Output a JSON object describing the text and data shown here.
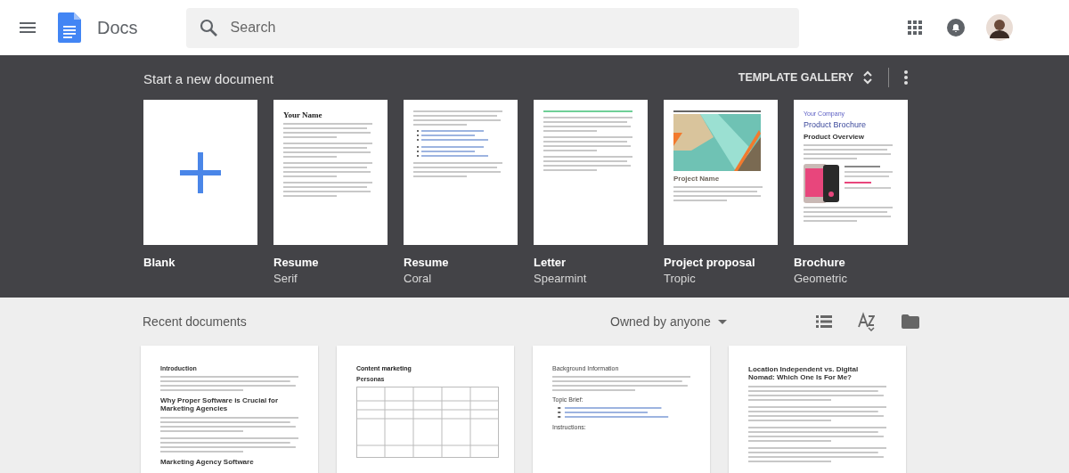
{
  "header": {
    "app_name": "Docs",
    "search": {
      "placeholder": "Search"
    }
  },
  "templates_section": {
    "title": "Start a new document",
    "gallery_button": "TEMPLATE GALLERY",
    "templates": [
      {
        "name": "Blank",
        "preview": [
          {
            "kind": "plus"
          }
        ]
      },
      {
        "name": "Resume",
        "variant": "Serif",
        "preview": [
          {
            "kind": "serif-title",
            "text": "Your Name"
          },
          {
            "kind": "lines"
          },
          {
            "kind": "lines"
          },
          {
            "kind": "lines"
          },
          {
            "kind": "lines"
          }
        ]
      },
      {
        "name": "Resume",
        "variant": "Coral",
        "preview": [
          {
            "kind": "lines"
          },
          {
            "kind": "bullets"
          },
          {
            "kind": "bullets"
          },
          {
            "kind": "lines"
          }
        ]
      },
      {
        "name": "Letter",
        "variant": "Spearmint",
        "preview": [
          {
            "kind": "rule"
          },
          {
            "kind": "lines"
          },
          {
            "kind": "lines"
          },
          {
            "kind": "lines"
          }
        ]
      },
      {
        "name": "Project proposal",
        "variant": "Tropic",
        "preview": [
          {
            "kind": "artwork"
          },
          {
            "kind": "condensed-title",
            "text": "Project Name"
          },
          {
            "kind": "lines"
          }
        ]
      },
      {
        "name": "Brochure",
        "variant": "Geometric",
        "preview": [
          {
            "kind": "brand",
            "text": "Your Company"
          },
          {
            "kind": "brand-title",
            "text": "Product Brochure"
          },
          {
            "kind": "heading",
            "text": "Product Overview"
          },
          {
            "kind": "lines"
          },
          {
            "kind": "phone"
          },
          {
            "kind": "lines"
          }
        ]
      }
    ]
  },
  "recent_section": {
    "title": "Recent documents",
    "owner_filter": "Owned by anyone",
    "documents": [
      {
        "preview": [
          {
            "kind": "small-heading",
            "text": "Introduction"
          },
          {
            "kind": "lines"
          },
          {
            "kind": "heading",
            "text": "Why Proper Software is Crucial for Marketing Agencies"
          },
          {
            "kind": "lines"
          },
          {
            "kind": "lines"
          },
          {
            "kind": "heading",
            "text": "Marketing Agency Software"
          }
        ]
      },
      {
        "preview": [
          {
            "kind": "title",
            "text": "Content marketing"
          },
          {
            "kind": "small-heading",
            "text": "Personas"
          },
          {
            "kind": "table"
          }
        ]
      },
      {
        "preview": [
          {
            "kind": "light-title",
            "text": "Background Information"
          },
          {
            "kind": "lines"
          },
          {
            "kind": "light-title",
            "text": "Topic Brief:"
          },
          {
            "kind": "bullets"
          },
          {
            "kind": "light-title",
            "text": "Instructions:"
          }
        ]
      },
      {
        "preview": [
          {
            "kind": "heading",
            "text": "Location Independent vs. Digital Nomad: Which One Is For Me?"
          },
          {
            "kind": "lines"
          },
          {
            "kind": "lines"
          },
          {
            "kind": "lines"
          },
          {
            "kind": "lines"
          }
        ]
      }
    ]
  }
}
